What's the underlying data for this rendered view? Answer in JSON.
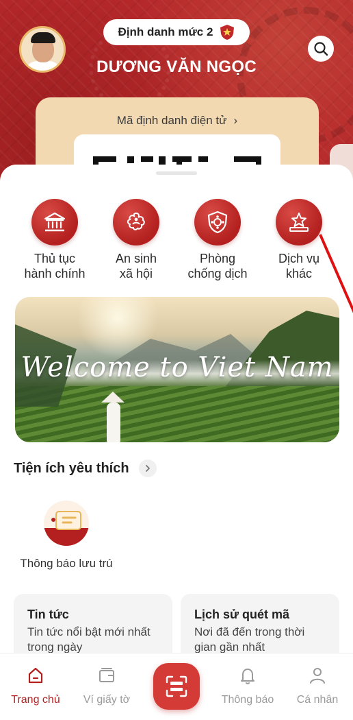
{
  "header": {
    "level_label": "Định danh mức 2",
    "user_name": "DƯƠNG VĂN NGỌC",
    "id_card_title": "Mã định danh điện tử",
    "id_card_chevron": "›"
  },
  "services": [
    {
      "line1": "Thủ tục",
      "line2": "hành chính",
      "icon": "bank-icon"
    },
    {
      "line1": "An sinh",
      "line2": "xã hội",
      "icon": "family-flower-icon"
    },
    {
      "line1": "Phòng",
      "line2": "chống dịch",
      "icon": "virus-shield-icon"
    },
    {
      "line1": "Dịch vụ",
      "line2": "khác",
      "icon": "star-podium-icon"
    }
  ],
  "banner": {
    "text": "Welcome to Viet Nam"
  },
  "favorites": {
    "title": "Tiện ích yêu thích",
    "items": [
      {
        "label": "Thông báo lưu trú",
        "icon": "chat-bubble-icon"
      }
    ]
  },
  "tiles": [
    {
      "title": "Tin tức",
      "desc": "Tin tức nổi bật mới nhất trong ngày"
    },
    {
      "title": "Lịch sử quét mã",
      "desc": "Nơi đã đến trong thời gian gần nhất"
    }
  ],
  "nav": {
    "home": "Trang chủ",
    "wallet": "Ví giấy tờ",
    "notifications": "Thông báo",
    "profile": "Cá nhân"
  },
  "colors": {
    "brand_red": "#b3201f",
    "header_red": "#b5282a",
    "card_beige": "#f3d9b2"
  }
}
